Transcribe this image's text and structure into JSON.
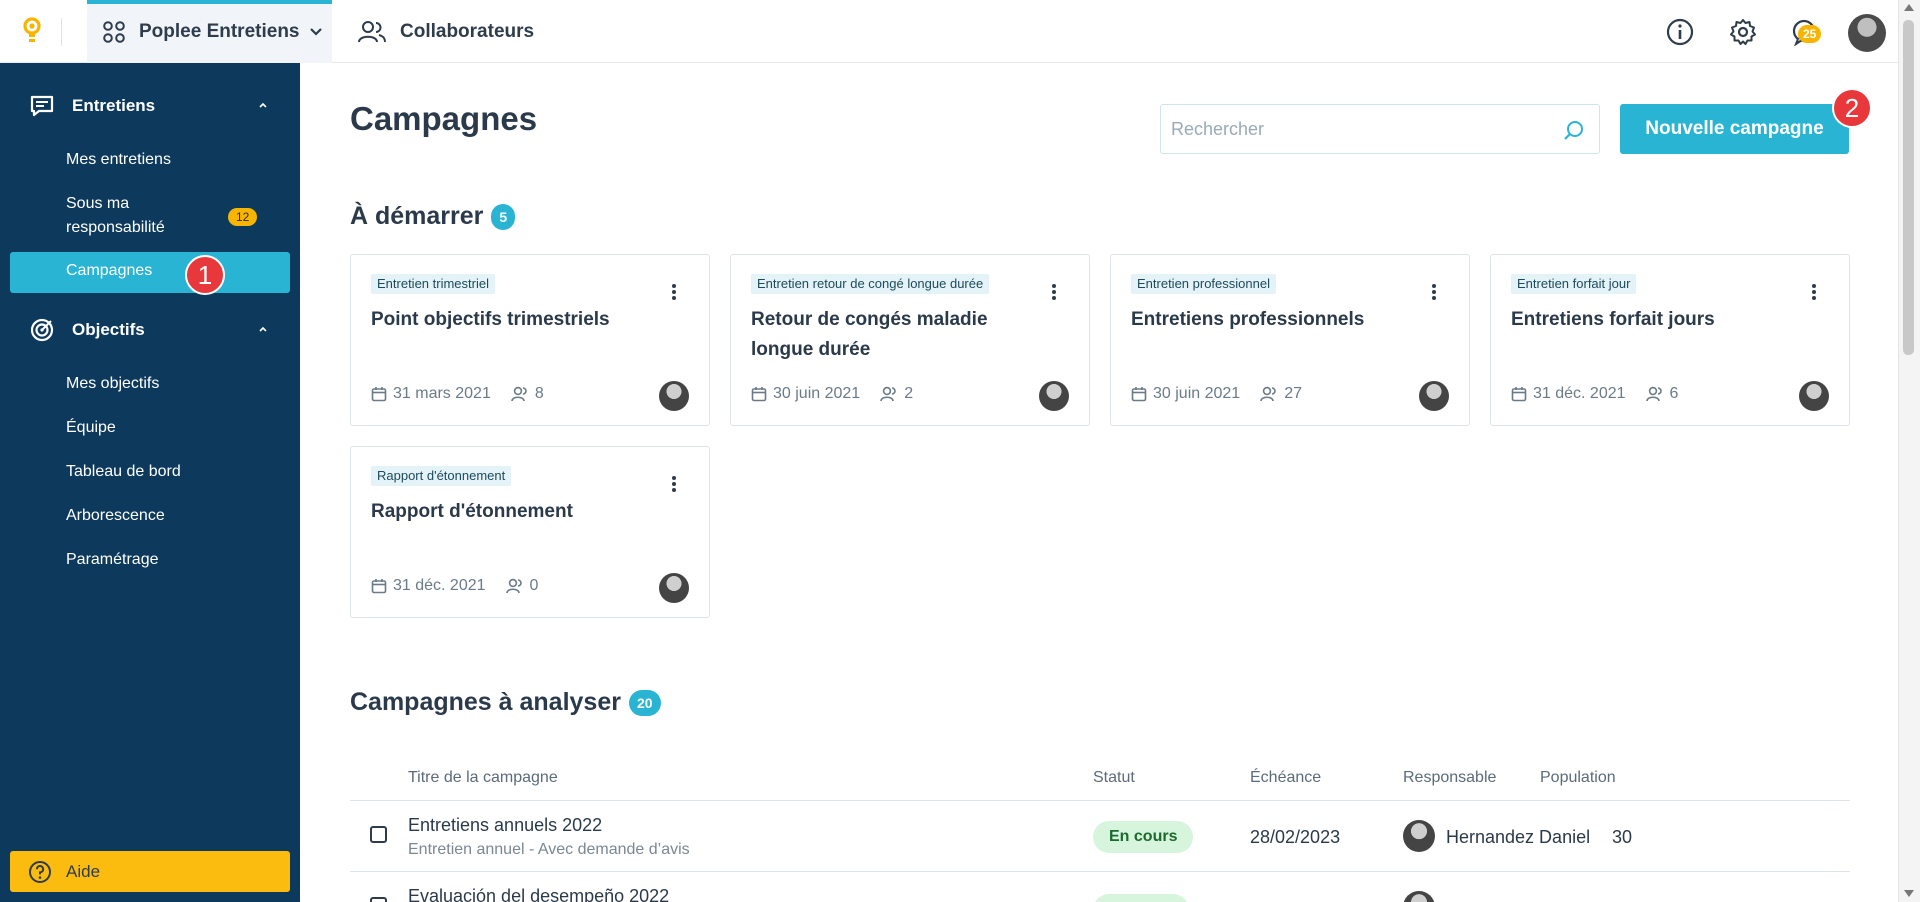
{
  "topbar": {
    "app_label": "Poplee Entretiens",
    "collab_label": "Collaborateurs",
    "notifications_count": "25"
  },
  "sidebar": {
    "entretiens": {
      "label": "Entretiens",
      "items": [
        {
          "label": "Mes entretiens"
        },
        {
          "label": "Sous ma responsabilité",
          "badge": "12"
        },
        {
          "label": "Campagnes"
        }
      ]
    },
    "objectifs": {
      "label": "Objectifs",
      "items": [
        {
          "label": "Mes objectifs"
        },
        {
          "label": "Équipe"
        },
        {
          "label": "Tableau de bord"
        },
        {
          "label": "Arborescence"
        },
        {
          "label": "Paramétrage"
        }
      ]
    },
    "help_label": "Aide"
  },
  "steps": {
    "one": "1",
    "two": "2"
  },
  "main": {
    "title": "Campagnes",
    "search_placeholder": "Rechercher",
    "new_button": "Nouvelle campagne",
    "to_start": {
      "title": "À démarrer",
      "count": "5",
      "cards": [
        {
          "tag": "Entretien trimestriel",
          "title": "Point objectifs trimestriels",
          "date": "31 mars 2021",
          "people": "8"
        },
        {
          "tag": "Entretien retour de congé longue durée",
          "title": "Retour de congés maladie longue durée",
          "date": "30 juin 2021",
          "people": "2"
        },
        {
          "tag": "Entretien professionnel",
          "title": "Entretiens professionnels",
          "date": "30 juin 2021",
          "people": "27"
        },
        {
          "tag": "Entretien forfait jour",
          "title": "Entretiens forfait jours",
          "date": "31 déc. 2021",
          "people": "6"
        },
        {
          "tag": "Rapport d'étonnement",
          "title": "Rapport d'étonnement",
          "date": "31 déc. 2021",
          "people": "0"
        }
      ]
    },
    "to_analyze": {
      "title": "Campagnes à analyser",
      "count": "20",
      "columns": [
        "Titre de la campagne",
        "Statut",
        "Échéance",
        "Responsable",
        "Population"
      ],
      "rows": [
        {
          "title": "Entretiens annuels 2022",
          "subtitle": "Entretien annuel - Avec demande d’avis",
          "status": "En cours",
          "due": "28/02/2023",
          "owner": "Hernandez Daniel",
          "population": "30"
        },
        {
          "title": "Evaluación del desempeño 2022",
          "subtitle": "",
          "status": "",
          "due": "",
          "owner": "",
          "population": ""
        }
      ]
    }
  },
  "colors": {
    "sidebar_bg": "#0d3a5c",
    "accent": "#2ab4d4",
    "warning": "#f7b500",
    "step_badge": "#e8383b",
    "status_bg": "#d7f5dc"
  },
  "icons": [
    "bulb-logo-icon",
    "grid-apps-icon",
    "chevron-down-icon",
    "users-icon",
    "info-icon",
    "gear-icon",
    "chat-icon",
    "comment-icon",
    "target-icon",
    "caret-up-icon",
    "help-circle-icon",
    "search-icon",
    "kebab-icon",
    "calendar-icon",
    "user-group-icon",
    "checkbox-icon"
  ]
}
